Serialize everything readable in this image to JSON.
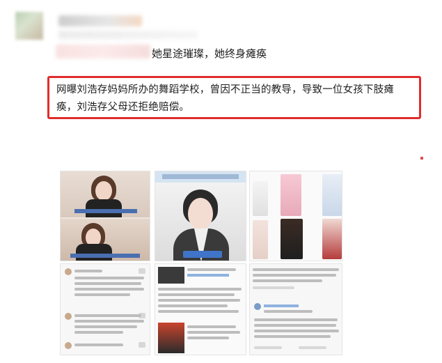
{
  "post": {
    "headline": "她星途璀璨，她终身瘫痪",
    "quote": "网曝刘浩存妈妈所办的舞蹈学校，曾因不正当的教导，导致一位女孩下肢瘫痪，刘浩存父母还拒绝赔偿。"
  },
  "thumbnails": [
    {
      "name": "thumb-interview-1"
    },
    {
      "name": "thumb-portrait"
    },
    {
      "name": "thumb-photo-grid"
    },
    {
      "name": "thumb-comments-1"
    },
    {
      "name": "thumb-comments-2"
    },
    {
      "name": "thumb-comments-3"
    }
  ],
  "colors": {
    "highlight_border": "#e02c2c"
  }
}
